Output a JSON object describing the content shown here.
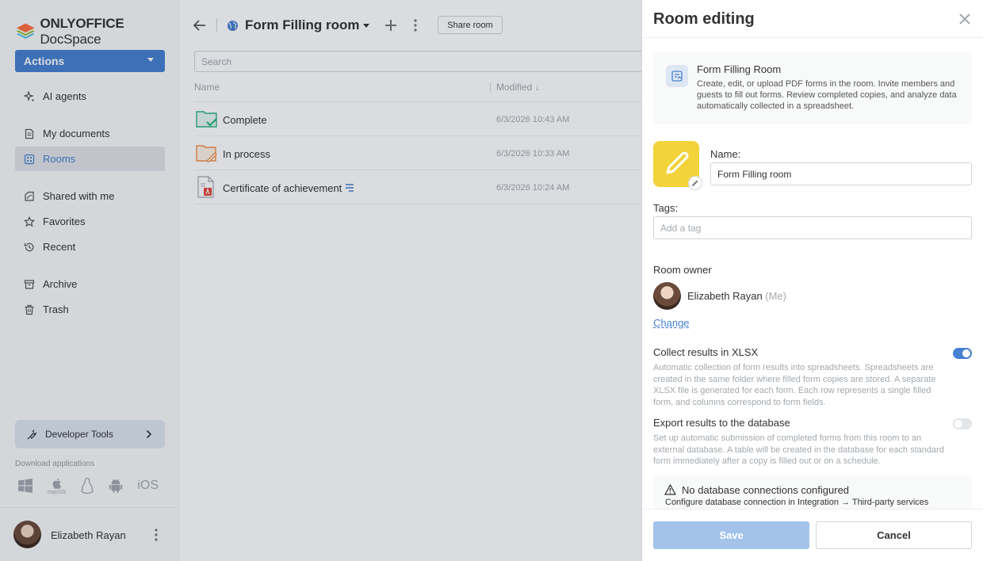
{
  "app": {
    "logo_brand": "ONLYOFFICE",
    "logo_product": "DocSpace"
  },
  "sidebar": {
    "actions_label": "Actions",
    "items": [
      {
        "label": "AI agents",
        "icon": "sparkle-icon"
      },
      {
        "label": "My documents",
        "icon": "document-icon"
      },
      {
        "label": "Rooms",
        "icon": "rooms-grid-icon",
        "active": true
      },
      {
        "label": "Shared with me",
        "icon": "shared-icon"
      },
      {
        "label": "Favorites",
        "icon": "star-icon"
      },
      {
        "label": "Recent",
        "icon": "history-icon"
      },
      {
        "label": "Archive",
        "icon": "archive-icon"
      },
      {
        "label": "Trash",
        "icon": "trash-icon"
      }
    ],
    "developer_tools_label": "Developer Tools",
    "download_label": "Download applications",
    "download_apps": [
      "Windows",
      "macOS",
      "Linux",
      "Android",
      "iOS"
    ],
    "macos_caption": "macOS",
    "ios_caption": "iOS",
    "user_name": "Elizabeth Rayan"
  },
  "main": {
    "room_title": "Form Filling room",
    "share_button": "Share room",
    "search_placeholder": "Search",
    "columns": {
      "name": "Name",
      "modified": "Modified"
    },
    "rows": [
      {
        "name": "Complete",
        "modified": "6/3/2026 10:43 AM",
        "icon": "folder-complete-icon"
      },
      {
        "name": "In process",
        "modified": "6/3/2026 10:33 AM",
        "icon": "folder-in-process-icon"
      },
      {
        "name": "Certificate of achievement",
        "modified": "6/3/2026 10:24 AM",
        "icon": "pdf-form-icon"
      }
    ]
  },
  "panel": {
    "title": "Room editing",
    "room_type_title": "Form Filling Room",
    "room_type_desc": "Create, edit, or upload PDF forms in the room. Invite members and guests to fill out forms. Review completed copies, and analyze data automatically collected in a spreadsheet.",
    "name_label": "Name:",
    "name_value": "Form Filling room",
    "tags_label": "Tags:",
    "tags_placeholder": "Add a tag",
    "owner_label": "Room owner",
    "owner_name": "Elizabeth Rayan",
    "owner_me": "(Me)",
    "change_link": "Change",
    "collect_label": "Collect results in XLSX",
    "collect_on": true,
    "collect_desc": "Automatic collection of form results into spreadsheets. Spreadsheets are created in the same folder where filled form copies are stored. A separate XLSX file is generated for each form. Each row represents a single filled form, and columns correspond to form fields.",
    "export_label": "Export results to the database",
    "export_on": false,
    "export_desc": "Set up automatic submission of completed forms from this room to an external database. A table will be created in the database for each standard form immediately after a copy is filled out or on a schedule.",
    "warn_title": "No database connections configured",
    "warn_desc": "Configure database connection in Integration → Third-party services",
    "save_label": "Save",
    "cancel_label": "Cancel"
  },
  "colors": {
    "accent": "#4781d1",
    "logo_yellow": "#f3d33a",
    "save_disabled": "#a3c3ea"
  }
}
